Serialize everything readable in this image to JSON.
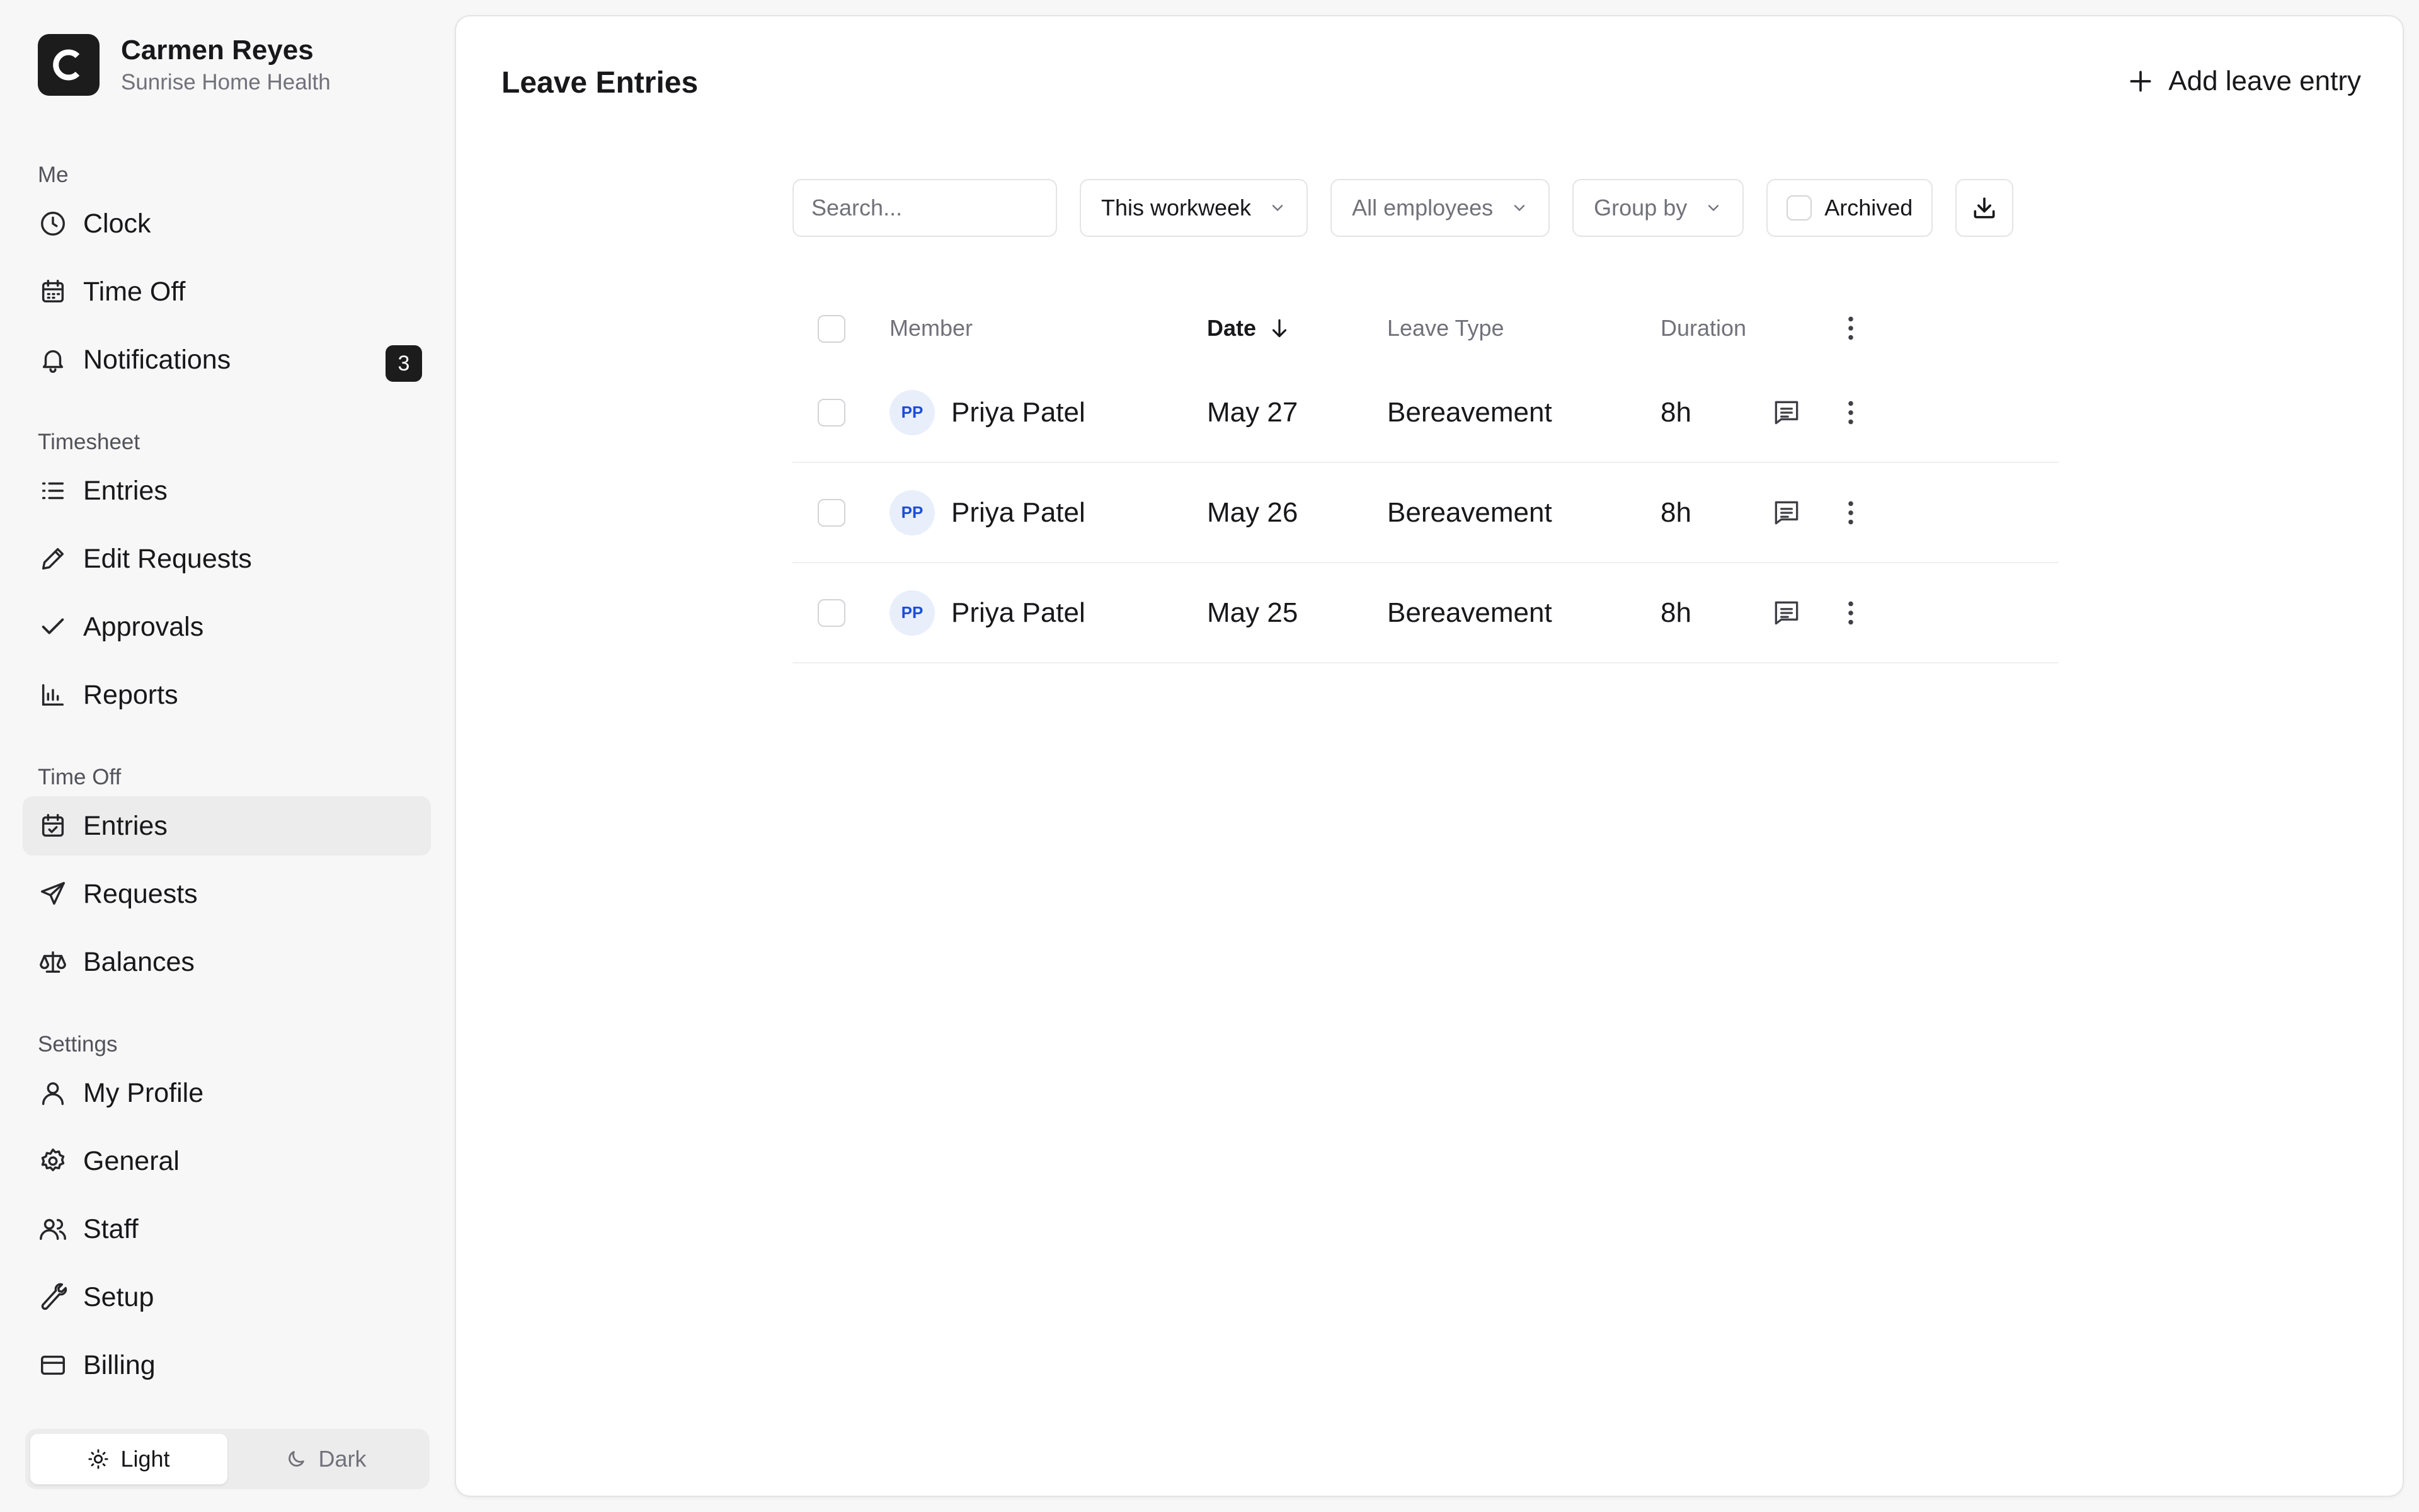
{
  "user": {
    "name": "Carmen Reyes",
    "org": "Sunrise Home Health",
    "logo_letter": "C"
  },
  "sidebar": {
    "sections": [
      {
        "title": "Me",
        "items": [
          {
            "label": "Clock",
            "icon": "clock-icon"
          },
          {
            "label": "Time Off",
            "icon": "calendar-icon"
          },
          {
            "label": "Notifications",
            "icon": "bell-icon",
            "badge": "3"
          }
        ]
      },
      {
        "title": "Timesheet",
        "items": [
          {
            "label": "Entries",
            "icon": "list-icon"
          },
          {
            "label": "Edit Requests",
            "icon": "pencil-icon"
          },
          {
            "label": "Approvals",
            "icon": "check-icon"
          },
          {
            "label": "Reports",
            "icon": "bar-chart-icon"
          }
        ]
      },
      {
        "title": "Time Off",
        "items": [
          {
            "label": "Entries",
            "icon": "calendar-check-icon",
            "active": true
          },
          {
            "label": "Requests",
            "icon": "send-icon"
          },
          {
            "label": "Balances",
            "icon": "scale-icon"
          }
        ]
      },
      {
        "title": "Settings",
        "items": [
          {
            "label": "My Profile",
            "icon": "user-icon"
          },
          {
            "label": "General",
            "icon": "gear-icon"
          },
          {
            "label": "Staff",
            "icon": "users-icon"
          },
          {
            "label": "Setup",
            "icon": "wrench-icon"
          },
          {
            "label": "Billing",
            "icon": "credit-card-icon"
          }
        ]
      }
    ],
    "theme": {
      "light": "Light",
      "dark": "Dark",
      "selected": "light"
    }
  },
  "main": {
    "title": "Leave Entries",
    "add_label": "Add leave entry",
    "toolbar": {
      "search_placeholder": "Search...",
      "period": "This workweek",
      "employees": "All employees",
      "group_by": "Group by",
      "archived": "Archived"
    },
    "table": {
      "columns": {
        "member": "Member",
        "date": "Date",
        "leave_type": "Leave Type",
        "duration": "Duration"
      },
      "rows": [
        {
          "initials": "PP",
          "member": "Priya Patel",
          "date": "May 27",
          "leave_type": "Bereavement",
          "duration": "8h"
        },
        {
          "initials": "PP",
          "member": "Priya Patel",
          "date": "May 26",
          "leave_type": "Bereavement",
          "duration": "8h"
        },
        {
          "initials": "PP",
          "member": "Priya Patel",
          "date": "May 25",
          "leave_type": "Bereavement",
          "duration": "8h"
        }
      ]
    }
  },
  "colors": {
    "accent": "#1c1c1c",
    "avatar_bg": "#e9eefb",
    "avatar_text": "#1d4ed8",
    "active_bg": "#ececec"
  }
}
